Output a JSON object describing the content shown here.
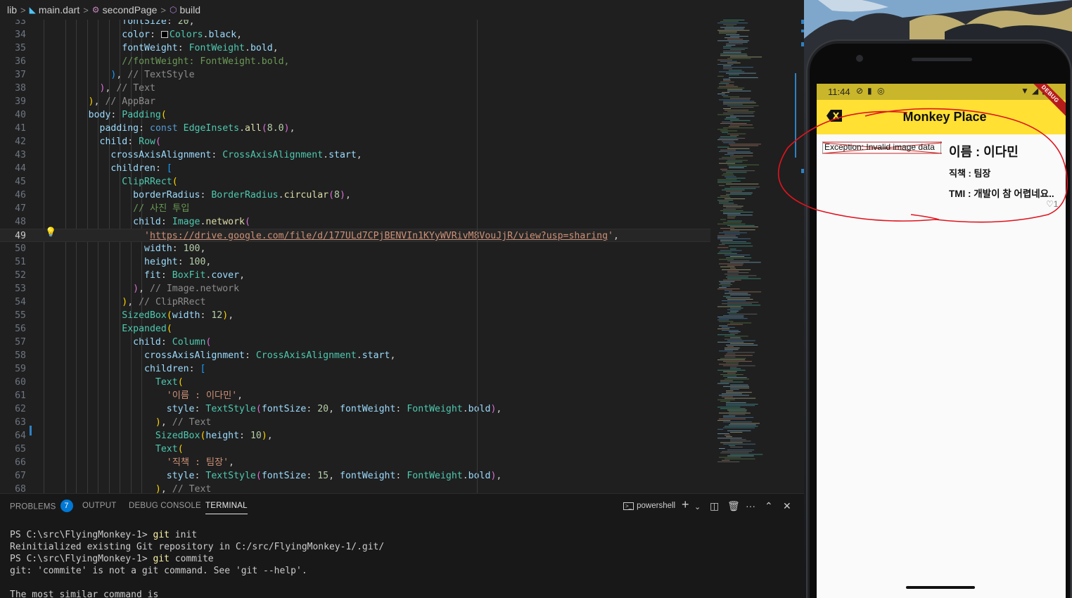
{
  "breadcrumb": {
    "items": [
      "lib",
      "main.dart",
      "secondPage",
      "build"
    ],
    "icons": [
      "chevron-right-icon",
      "dart-icon",
      "method-icon",
      "cube-icon"
    ]
  },
  "editor": {
    "active_line": 49,
    "lines": [
      {
        "n": 33,
        "html": "            <span class='p'>fontSize</span>: <span class='n'>20</span>,"
      },
      {
        "n": 34,
        "html": "            <span class='p'>color</span>: <span style='display:inline-block;width:10px;height:10px;border:1px solid #ccc;background:#000;vertical-align:-1px;margin-right:2px'></span><span class='t'>Colors</span>.<span class='p'>black</span>,"
      },
      {
        "n": 35,
        "html": "            <span class='p'>fontWeight</span>: <span class='t'>FontWeight</span>.<span class='p'>bold</span>,"
      },
      {
        "n": 36,
        "html": "            <span class='c'>//fontWeight: FontWeight.bold,</span>"
      },
      {
        "n": 37,
        "html": "          <span class='br3'>)</span>, <span class='g'>// TextStyle</span>"
      },
      {
        "n": 38,
        "html": "        <span class='br2'>)</span>, <span class='g'>// Text</span>"
      },
      {
        "n": 39,
        "html": "      <span class='br1'>)</span>, <span class='g'>// AppBar</span>"
      },
      {
        "n": 40,
        "html": "      <span class='p'>body</span>: <span class='t'>Padding</span><span class='br1'>(</span>"
      },
      {
        "n": 41,
        "html": "        <span class='p'>padding</span>: <span class='k'>const</span> <span class='t'>EdgeInsets</span>.<span class='f'>all</span><span class='br2'>(</span><span class='n'>8.0</span><span class='br2'>)</span>,"
      },
      {
        "n": 42,
        "html": "        <span class='p'>child</span>: <span class='t'>Row</span><span class='br2'>(</span>"
      },
      {
        "n": 43,
        "html": "          <span class='p'>crossAxisAlignment</span>: <span class='t'>CrossAxisAlignment</span>.<span class='p'>start</span>,"
      },
      {
        "n": 44,
        "html": "          <span class='p'>children</span>: <span class='br3'>[</span>"
      },
      {
        "n": 45,
        "html": "            <span class='t'>ClipRRect</span><span class='br1'>(</span>"
      },
      {
        "n": 46,
        "html": "              <span class='p'>borderRadius</span>: <span class='t'>BorderRadius</span>.<span class='f'>circular</span><span class='br2'>(</span><span class='n'>8</span><span class='br2'>)</span>,"
      },
      {
        "n": 47,
        "html": "              <span class='c'>// 사진 투입</span>"
      },
      {
        "n": 48,
        "html": "              <span class='p'>child</span>: <span class='t'>Image</span>.<span class='f'>network</span><span class='br2'>(</span>"
      },
      {
        "n": 49,
        "html": "                <span class='s'>'<span class='u'>https://drive.google.com/file/d/177ULd7CPjBENVIn1KYyWVRivM8VouJjR/view?usp=sharing</span>'</span>,"
      },
      {
        "n": 50,
        "html": "                <span class='p'>width</span>: <span class='n'>100</span>,"
      },
      {
        "n": 51,
        "html": "                <span class='p'>height</span>: <span class='n'>100</span>,"
      },
      {
        "n": 52,
        "html": "                <span class='p'>fit</span>: <span class='t'>BoxFit</span>.<span class='p'>cover</span>,"
      },
      {
        "n": 53,
        "html": "              <span class='br2'>)</span>, <span class='g'>// Image.network</span>"
      },
      {
        "n": 54,
        "html": "            <span class='br1'>)</span>, <span class='g'>// ClipRRect</span>"
      },
      {
        "n": 55,
        "html": "            <span class='t'>SizedBox</span><span class='br1'>(</span><span class='p'>width</span>: <span class='n'>12</span><span class='br1'>)</span>,"
      },
      {
        "n": 56,
        "html": "            <span class='t'>Expanded</span><span class='br1'>(</span>"
      },
      {
        "n": 57,
        "html": "              <span class='p'>child</span>: <span class='t'>Column</span><span class='br2'>(</span>"
      },
      {
        "n": 58,
        "html": "                <span class='p'>crossAxisAlignment</span>: <span class='t'>CrossAxisAlignment</span>.<span class='p'>start</span>,"
      },
      {
        "n": 59,
        "html": "                <span class='p'>children</span>: <span class='br3'>[</span>"
      },
      {
        "n": 60,
        "html": "                  <span class='t'>Text</span><span class='br1'>(</span>"
      },
      {
        "n": 61,
        "html": "                    <span class='s'>'이름 : 이다민'</span>,"
      },
      {
        "n": 62,
        "html": "                    <span class='p'>style</span>: <span class='t'>TextStyle</span><span class='br2'>(</span><span class='p'>fontSize</span>: <span class='n'>20</span>, <span class='p'>fontWeight</span>: <span class='t'>FontWeight</span>.<span class='p'>bold</span><span class='br2'>)</span>,"
      },
      {
        "n": 63,
        "html": "                  <span class='br1'>)</span>, <span class='g'>// Text</span>"
      },
      {
        "n": 64,
        "html": "                  <span class='t'>SizedBox</span><span class='br1'>(</span><span class='p'>height</span>: <span class='n'>10</span><span class='br1'>)</span>,"
      },
      {
        "n": 65,
        "html": "                  <span class='t'>Text</span><span class='br1'>(</span>"
      },
      {
        "n": 66,
        "html": "                    <span class='s'>'직책 : 팀장'</span>,"
      },
      {
        "n": 67,
        "html": "                    <span class='p'>style</span>: <span class='t'>TextStyle</span><span class='br2'>(</span><span class='p'>fontSize</span>: <span class='n'>15</span>, <span class='p'>fontWeight</span>: <span class='t'>FontWeight</span>.<span class='p'>bold</span><span class='br2'>)</span>,"
      },
      {
        "n": 68,
        "html": "                  <span class='br1'>)</span>, <span class='g'>// Text</span>"
      }
    ]
  },
  "panel": {
    "tabs": [
      "PROBLEMS",
      "OUTPUT",
      "DEBUG CONSOLE",
      "TERMINAL"
    ],
    "problems_count": "7",
    "active_tab": "TERMINAL",
    "shell_label": "powershell",
    "actions": [
      "new-terminal-icon",
      "chevron-down-icon",
      "split-icon",
      "trash-icon",
      "more-icon",
      "maximize-icon",
      "close-icon"
    ],
    "terminal": [
      {
        "prompt": "PS C:\\src\\FlyingMonkey-1> ",
        "cmd": "git",
        "rest": " init"
      },
      {
        "prompt": "Reinitialized existing Git repository in C:/src/FlyingMonkey-1/.git/",
        "cmd": "",
        "rest": ""
      },
      {
        "prompt": "PS C:\\src\\FlyingMonkey-1> ",
        "cmd": "git",
        "rest": " commite"
      },
      {
        "prompt": "git: 'commite' is not a git command. See 'git --help'.",
        "cmd": "",
        "rest": ""
      },
      {
        "prompt": "",
        "cmd": "",
        "rest": ""
      },
      {
        "prompt": "The most similar command is",
        "cmd": "",
        "rest": ""
      }
    ]
  },
  "phone": {
    "status_time": "11:44",
    "debug_label": "DEBUG",
    "appbar_title": "Monkey Place",
    "error_text": "Exception: Invalid image data",
    "name": "이름 : 이다민",
    "role": "직책 : 팀장",
    "tmi": "TMI : 개발이 참 어렵네요..",
    "likes": "1"
  },
  "colors": {
    "appbar": "#ffe033",
    "statusbar": "#c9b62a",
    "annotation": "#e0141e",
    "accent": "#0078d4"
  }
}
